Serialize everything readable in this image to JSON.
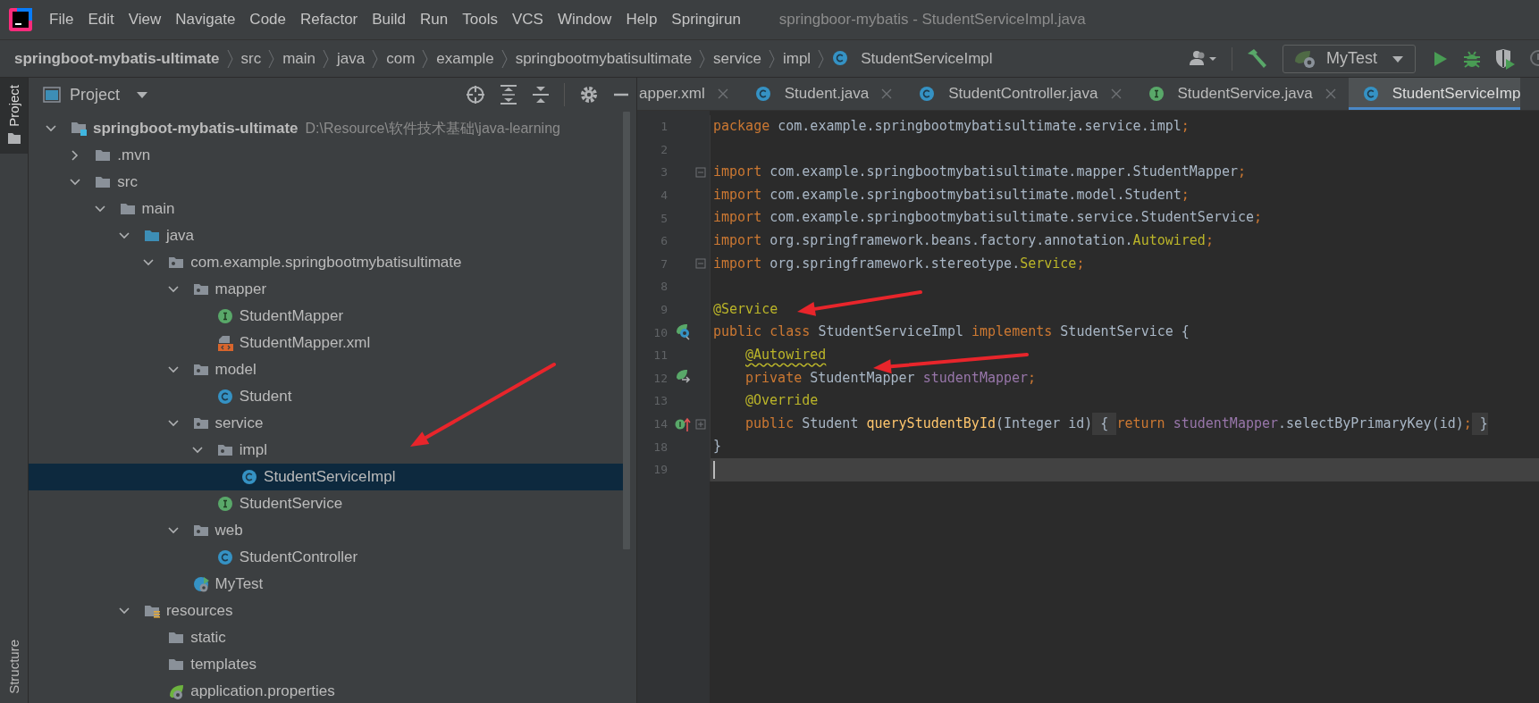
{
  "window": {
    "title": "springboor-mybatis - StudentServiceImpl.java"
  },
  "menu": [
    "File",
    "Edit",
    "View",
    "Navigate",
    "Code",
    "Refactor",
    "Build",
    "Run",
    "Tools",
    "VCS",
    "Window",
    "Help",
    "Springirun"
  ],
  "breadcrumbs": [
    {
      "label": "springboot-mybatis-ultimate",
      "kind": "project"
    },
    {
      "label": "src",
      "kind": "dir"
    },
    {
      "label": "main",
      "kind": "dir"
    },
    {
      "label": "java",
      "kind": "dir"
    },
    {
      "label": "com",
      "kind": "dir"
    },
    {
      "label": "example",
      "kind": "dir"
    },
    {
      "label": "springbootmybatisultimate",
      "kind": "dir"
    },
    {
      "label": "service",
      "kind": "dir"
    },
    {
      "label": "impl",
      "kind": "dir"
    },
    {
      "label": "StudentServiceImpl",
      "kind": "class"
    }
  ],
  "run_config": {
    "label": "MyTest"
  },
  "tool_stripe": [
    {
      "label": "Project",
      "selected": true
    },
    {
      "label": "Structure",
      "selected": false
    }
  ],
  "project_panel": {
    "title": "Project",
    "tree": [
      {
        "label": "springboot-mybatis-ultimate",
        "kind": "module",
        "note": "D:\\Resource\\软件技术基础\\java-learning",
        "expanded": true,
        "selected": false,
        "children": [
          {
            "label": ".mvn",
            "kind": "folder",
            "expanded": false,
            "selected": false
          },
          {
            "label": "src",
            "kind": "folder",
            "expanded": true,
            "selected": false,
            "children": [
              {
                "label": "main",
                "kind": "folder",
                "expanded": true,
                "selected": false,
                "children": [
                  {
                    "label": "java",
                    "kind": "source",
                    "expanded": true,
                    "selected": false,
                    "children": [
                      {
                        "label": "com.example.springbootmybatisultimate",
                        "kind": "package",
                        "expanded": true,
                        "selected": false,
                        "children": [
                          {
                            "label": "mapper",
                            "kind": "package",
                            "expanded": true,
                            "selected": false,
                            "children": [
                              {
                                "label": "StudentMapper",
                                "kind": "interface",
                                "selected": false
                              },
                              {
                                "label": "StudentMapper.xml",
                                "kind": "xml",
                                "selected": false
                              }
                            ]
                          },
                          {
                            "label": "model",
                            "kind": "package",
                            "expanded": true,
                            "selected": false,
                            "children": [
                              {
                                "label": "Student",
                                "kind": "class",
                                "selected": false
                              }
                            ]
                          },
                          {
                            "label": "service",
                            "kind": "package",
                            "expanded": true,
                            "selected": false,
                            "children": [
                              {
                                "label": "impl",
                                "kind": "package",
                                "expanded": true,
                                "selected": false,
                                "children": [
                                  {
                                    "label": "StudentServiceImpl",
                                    "kind": "class",
                                    "selected": true
                                  }
                                ]
                              },
                              {
                                "label": "StudentService",
                                "kind": "interface",
                                "selected": false
                              }
                            ]
                          },
                          {
                            "label": "web",
                            "kind": "package",
                            "expanded": true,
                            "selected": false,
                            "children": [
                              {
                                "label": "StudentController",
                                "kind": "class",
                                "selected": false
                              }
                            ]
                          },
                          {
                            "label": "MyTest",
                            "kind": "boot",
                            "selected": false
                          }
                        ]
                      }
                    ]
                  },
                  {
                    "label": "resources",
                    "kind": "resources",
                    "expanded": true,
                    "selected": false,
                    "children": [
                      {
                        "label": "static",
                        "kind": "folder",
                        "selected": false
                      },
                      {
                        "label": "templates",
                        "kind": "folder",
                        "selected": false
                      },
                      {
                        "label": "application.properties",
                        "kind": "properties",
                        "selected": false
                      }
                    ]
                  }
                ]
              }
            ]
          }
        ]
      }
    ]
  },
  "editor_tabs": [
    {
      "label": "apper.xml",
      "selected": false
    },
    {
      "label": "Student.java",
      "kind": "class",
      "selected": false
    },
    {
      "label": "StudentController.java",
      "kind": "class",
      "selected": false
    },
    {
      "label": "StudentService.java",
      "kind": "interface",
      "selected": false
    },
    {
      "label": "StudentServiceImp",
      "kind": "class",
      "selected": true
    }
  ],
  "editor": {
    "lines": [
      {
        "number": "1",
        "indented": false,
        "tokens": [
          {
            "text": "package ",
            "kind": "kw"
          },
          {
            "text": "com.example.springbootmybatisultimate.service.impl",
            "kind": "plain"
          },
          {
            "text": ";",
            "kind": "kw"
          }
        ]
      },
      {
        "number": "2"
      },
      {
        "number": "3",
        "indented": false,
        "fold": {
          "kind": "start"
        },
        "tokens": [
          {
            "text": "import ",
            "kind": "kw"
          },
          {
            "text": "com.example.springbootmybatisultimate.mapper.StudentMapper",
            "kind": "plain"
          },
          {
            "text": ";",
            "kind": "kw"
          }
        ]
      },
      {
        "number": "4",
        "indented": false,
        "tokens": [
          {
            "text": "import ",
            "kind": "kw"
          },
          {
            "text": "com.example.springbootmybatisultimate.model.Student",
            "kind": "plain"
          },
          {
            "text": ";",
            "kind": "kw"
          }
        ]
      },
      {
        "number": "5",
        "indented": false,
        "tokens": [
          {
            "text": "import ",
            "kind": "kw"
          },
          {
            "text": "com.example.springbootmybatisultimate.service.StudentService",
            "kind": "plain"
          },
          {
            "text": ";",
            "kind": "kw"
          }
        ]
      },
      {
        "number": "6",
        "indented": false,
        "tokens": [
          {
            "text": "import ",
            "kind": "kw"
          },
          {
            "text": "org.springframework.beans.factory.annotation.",
            "kind": "plain"
          },
          {
            "text": "Autowired",
            "kind": "ann"
          },
          {
            "text": ";",
            "kind": "kw"
          }
        ]
      },
      {
        "number": "7",
        "indented": false,
        "fold": {
          "kind": "end"
        },
        "tokens": [
          {
            "text": "import ",
            "kind": "kw"
          },
          {
            "text": "org.springframework.stereotype.",
            "kind": "plain"
          },
          {
            "text": "Service",
            "kind": "ann"
          },
          {
            "text": ";",
            "kind": "kw"
          }
        ]
      },
      {
        "number": "8"
      },
      {
        "number": "9",
        "indented": false,
        "tokens": [
          {
            "text": "@Service",
            "kind": "ann"
          }
        ]
      },
      {
        "number": "10",
        "indented": false,
        "gutter_icon": {
          "kind": "bean"
        },
        "tokens": [
          {
            "text": "public class ",
            "kind": "kw"
          },
          {
            "text": "StudentServiceImpl ",
            "kind": "plain"
          },
          {
            "text": "implements ",
            "kind": "kw"
          },
          {
            "text": "StudentService {",
            "kind": "plain"
          }
        ]
      },
      {
        "number": "11",
        "indented": true,
        "tokens": [
          {
            "text": "@Autowired",
            "kind": "warn"
          }
        ]
      },
      {
        "number": "12",
        "indented": true,
        "gutter_icon": {
          "kind": "inject"
        },
        "tokens": [
          {
            "text": "private ",
            "kind": "kw"
          },
          {
            "text": "StudentMapper ",
            "kind": "plain"
          },
          {
            "text": "studentMapper",
            "kind": "field"
          },
          {
            "text": ";",
            "kind": "kw"
          }
        ]
      },
      {
        "number": "13",
        "indented": true,
        "tokens": [
          {
            "text": "@Override",
            "kind": "ann"
          }
        ]
      },
      {
        "number": "14",
        "indented": true,
        "gutter_icon": {
          "kind": "implements"
        },
        "fold": {
          "kind": "collapsed"
        },
        "tokens": [
          {
            "text": "public ",
            "kind": "kw"
          },
          {
            "text": "Student ",
            "kind": "plain"
          },
          {
            "text": "queryStudentById",
            "kind": "method"
          },
          {
            "text": "(Integer id)",
            "kind": "plain"
          },
          {
            "text": " { ",
            "kind": "folded"
          },
          {
            "text": "return ",
            "kind": "kw"
          },
          {
            "text": "studentMapper",
            "kind": "field"
          },
          {
            "text": ".selectByPrimaryKey(id)",
            "kind": "plain"
          },
          {
            "text": ";",
            "kind": "kw"
          },
          {
            "text": " }",
            "kind": "folded"
          }
        ]
      },
      {
        "number": "18",
        "indented": false,
        "tokens": [
          {
            "text": "}",
            "kind": "plain"
          }
        ]
      },
      {
        "number": "19",
        "current": true
      }
    ]
  }
}
